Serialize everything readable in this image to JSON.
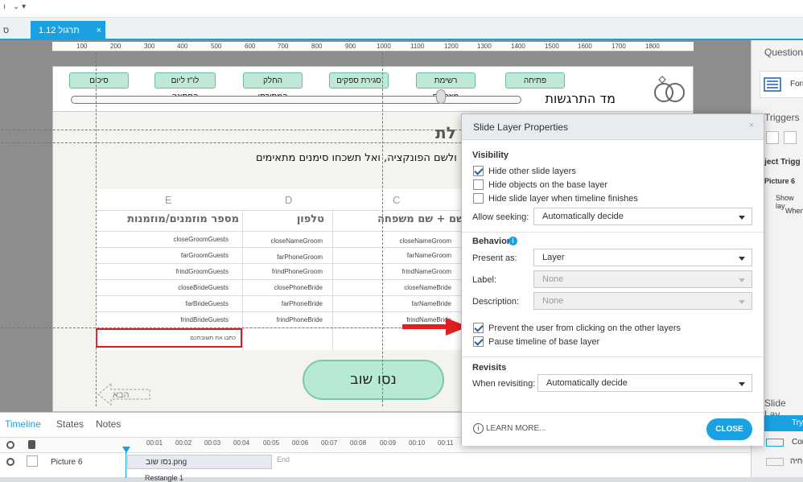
{
  "quick_access": {
    "left_glyph": "ı",
    "right_glyph": "⌄ ▾"
  },
  "tabs": [
    {
      "label": "ס"
    },
    {
      "label": "1.12 תרגול SUM"
    }
  ],
  "tab_close": "×",
  "ruler_ticks": [
    "100",
    "200",
    "300",
    "400",
    "500",
    "600",
    "700",
    "800",
    "900",
    "1000",
    "1100",
    "1200",
    "1300",
    "1400",
    "1500",
    "1600",
    "1700",
    "1800"
  ],
  "slide": {
    "nav_items": [
      "פתיחה",
      "רשימת מוזמנים",
      "סגירת ספקים",
      "החלק המסורתי",
      "לו\"ז ליום החתונה",
      "סיכום"
    ],
    "header_title": "מד התרגשות",
    "heading": "לת",
    "instructions": "רים ולשם הפונקציה, ואל תשכחו סימנים מתאימים.",
    "columns": [
      {
        "letter": "E",
        "header": "מספר מוזמנים/מוזמנות"
      },
      {
        "letter": "D",
        "header": "טלפון"
      },
      {
        "letter": "C",
        "header": "שם + שם משפחה"
      }
    ],
    "rows": [
      [
        "closeGroomGuests",
        "closeNameGroom",
        "closeNameGroom"
      ],
      [
        "farGroomGuests",
        "farPhoneGroom",
        "farNameGroom"
      ],
      [
        "frindGroomGuests",
        "frindPhoneGroom",
        "frindNameGroom"
      ],
      [
        "closeBrideGuests",
        "closePhoneBride",
        "closeNameBride"
      ],
      [
        "farBrideGuests",
        "farPhoneBride",
        "farNameBride"
      ],
      [
        "frindBrideGuests",
        "frindPhoneBride",
        "frindNameBride"
      ]
    ],
    "answer_placeholder": "כתבו את תשובתכם",
    "retry_label": "נסו שוב",
    "next_label": "הבא"
  },
  "right_panel": {
    "question_title": "Question",
    "form_label": "Forr",
    "triggers_title": "Triggers",
    "object_triggers": "bject Trigg",
    "trigger_item": "Picture 6",
    "show_layer": "Show lay",
    "when": "When",
    "slide_layers_title": "Slide Lay",
    "layer_try": "Try",
    "layer_cor": "Cor",
    "layer_ptich": "חיה"
  },
  "dialog": {
    "title": "Slide Layer Properties",
    "close_glyph": "×",
    "visibility_title": "Visibility",
    "visibility_options": [
      {
        "label": "Hide other slide layers",
        "checked": true
      },
      {
        "label": "Hide objects on the base layer",
        "checked": false
      },
      {
        "label": "Hide slide layer when timeline finishes",
        "checked": false
      }
    ],
    "allow_seeking_label": "Allow seeking:",
    "allow_seeking_value": "Automatically decide",
    "behavior_title": "Behavior",
    "present_as_label": "Present as:",
    "present_as_value": "Layer",
    "label_label": "Label:",
    "label_value": "None",
    "description_label": "Description:",
    "description_value": "None",
    "behavior_options": [
      {
        "label": "Prevent the user from clicking on the other layers",
        "checked": true
      },
      {
        "label": "Pause timeline of base layer",
        "checked": true
      }
    ],
    "revisits_title": "Revisits",
    "when_revisiting_label": "When revisiting:",
    "when_revisiting_value": "Automatically decide",
    "learn_more": "LEARN MORE...",
    "close_button": "CLOSE"
  },
  "timeline": {
    "tabs": [
      "Timeline",
      "States",
      "Notes"
    ],
    "ticks": [
      "00:01",
      "00:02",
      "00:03",
      "00:04",
      "00:05",
      "00:06",
      "00:07",
      "00:08",
      "00:09",
      "00:10",
      "00:11"
    ],
    "row_name": "Picture 6",
    "row_file": "נסו שוב.png",
    "row2_name": "Restangle 1",
    "end_label": "End"
  },
  "colors": {
    "accent": "#1ba1e2",
    "arrow_red": "#e02020",
    "mint": "#b6ead2"
  }
}
